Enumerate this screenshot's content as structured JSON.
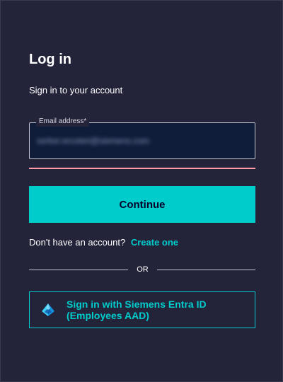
{
  "login": {
    "title": "Log in",
    "subtitle": "Sign in to your account",
    "email_label": "Email address*",
    "email_value": "serker.ercoteri@siemens.com",
    "continue_label": "Continue",
    "no_account_text": "Don't have an account?",
    "create_link": "Create one",
    "or_text": "OR",
    "sso_label": "Sign in with Siemens Entra ID (Employees AAD)",
    "sso_icon": "azure-entra-pyramid-icon"
  },
  "colors": {
    "background": "#23233a",
    "accent": "#00cccc",
    "error_underline": "#ff98a7",
    "field_background": "#0f1d3b"
  }
}
